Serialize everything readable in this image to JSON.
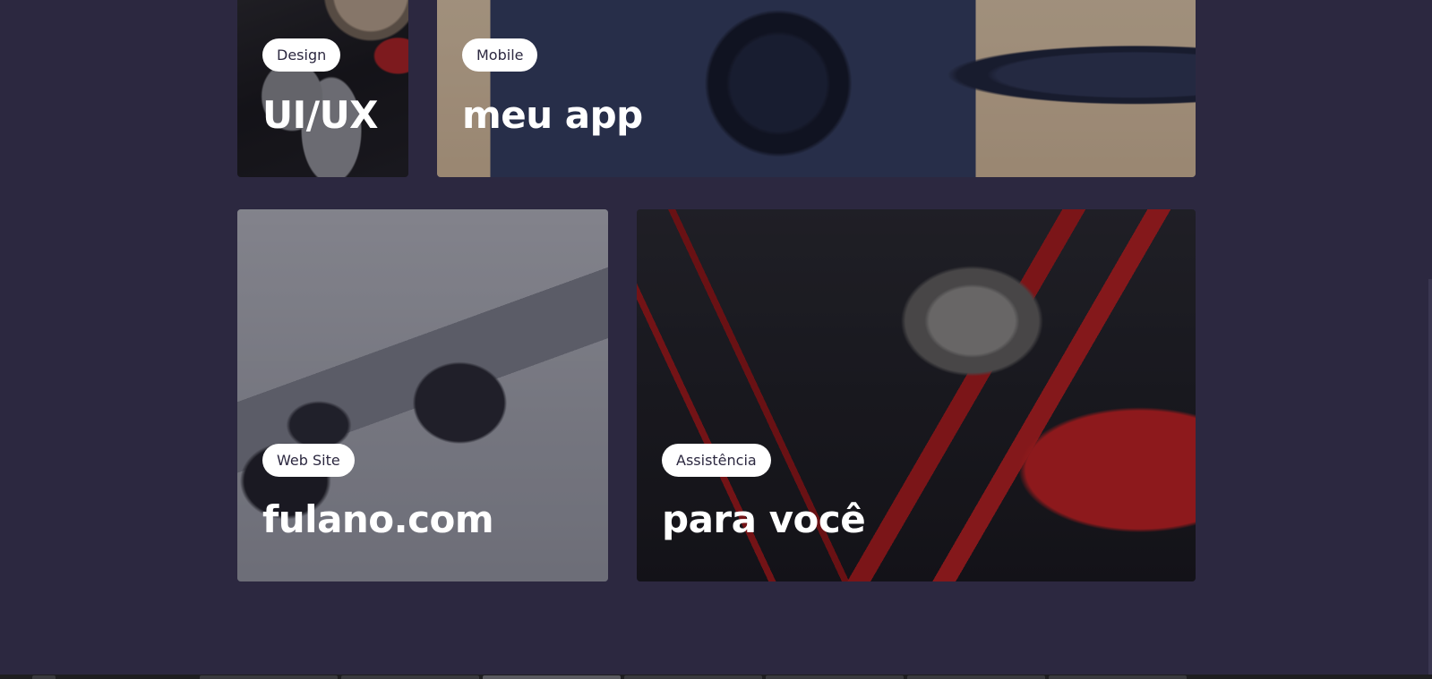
{
  "portfolio": {
    "cards": [
      {
        "tag": "Design",
        "title": "UI/UX"
      },
      {
        "tag": "Mobile",
        "title": "meu app"
      },
      {
        "tag": "Web Site",
        "title": "fulano.com"
      },
      {
        "tag": "Assistência",
        "title": "para você"
      }
    ]
  },
  "colors": {
    "background": "#2c2840",
    "tag_background": "#ffffff",
    "tag_text": "#2c2840",
    "title_text": "#ffffff"
  }
}
